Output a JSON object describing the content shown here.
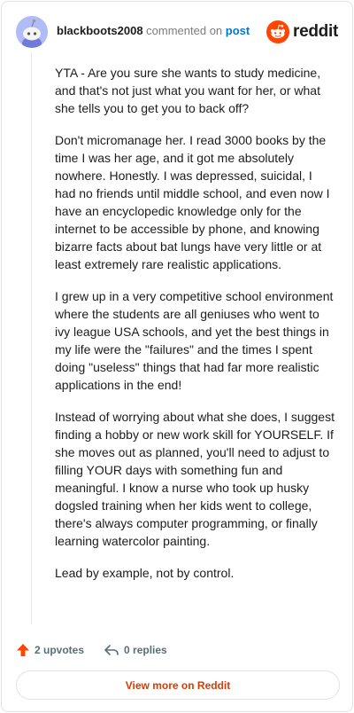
{
  "comment": {
    "username": "blackboots2008",
    "action": "commented on",
    "target_link": "post"
  },
  "brand": {
    "name": "reddit",
    "accent_color": "#ff4500"
  },
  "paragraphs": [
    "YTA - Are you sure she wants to study medicine, and that's not just what you want for her, or what she tells you to get you to back off?",
    "Don't micromanage her. I read 3000 books by the time I was her age, and it got me absolutely nowhere. Honestly. I was depressed, suicidal, I had no friends until middle school, and even now I have an encyclopedic knowledge only for the internet to be accessible by phone, and knowing bizarre facts about bat lungs have very little or at least extremely rare realistic applications.",
    "I grew up in a very competitive school environment where the students are all geniuses who went to ivy league USA schools, and yet the best things in my life were the \"failures\" and the times I spent doing \"useless\" things that had far more realistic applications in the end!",
    "Instead of worrying about what she does, I suggest finding a hobby or new work skill for YOURSELF. If she moves out as planned, you'll need to adjust to filling YOUR days with something fun and meaningful. I know a nurse who took up husky dogsled training when her kids went to college, there's always computer programming, or finally learning watercolor painting.",
    "Lead by example, not by control."
  ],
  "footer": {
    "upvotes": "2 upvotes",
    "replies": "0 replies",
    "upvote_icon": "upvote-arrow-icon",
    "reply_icon": "reply-arrow-icon"
  },
  "view_more_label": "View more on Reddit"
}
